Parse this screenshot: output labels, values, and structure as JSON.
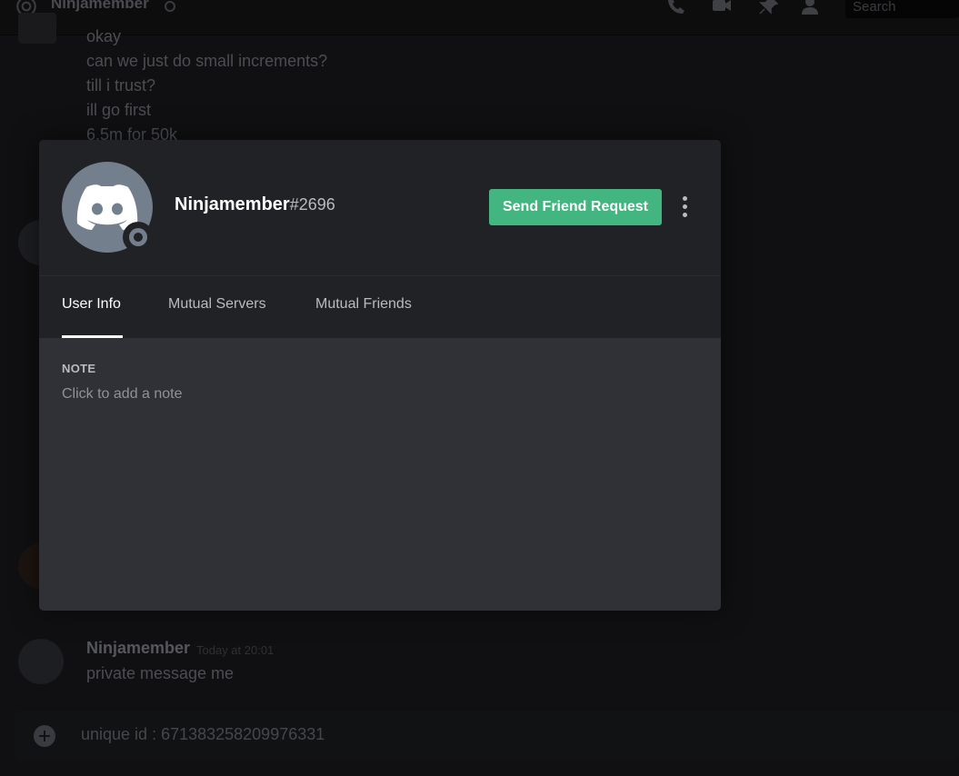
{
  "topbar": {
    "channel_name": "Ninjamember",
    "search_placeholder": "Search",
    "icons": [
      "at-icon",
      "phone-call-icon",
      "video-call-icon",
      "pin-icon",
      "add-member-icon"
    ]
  },
  "chat": {
    "messages_top": [
      "okay",
      "can we just do small increments?",
      "till i trust?",
      "ill go first",
      "6.5m for 50k"
    ],
    "last_message": {
      "author": "Ninjamember",
      "timestamp": "Today at 20:01",
      "text": "private message me"
    },
    "composer_placeholder": "unique id : 671383258209976331"
  },
  "profile": {
    "username": "Ninjamember",
    "discriminator": "#2696",
    "send_friend_request_label": "Send Friend Request",
    "tabs": [
      {
        "label": "User Info",
        "active": true
      },
      {
        "label": "Mutual Servers",
        "active": false
      },
      {
        "label": "Mutual Friends",
        "active": false
      }
    ],
    "note_label": "NOTE",
    "note_placeholder": "Click to add a note"
  },
  "colors": {
    "accent_green": "#43b581",
    "modal_bg": "#2f3136",
    "header_bg": "#202225",
    "avatar_bg": "#747f8d"
  }
}
